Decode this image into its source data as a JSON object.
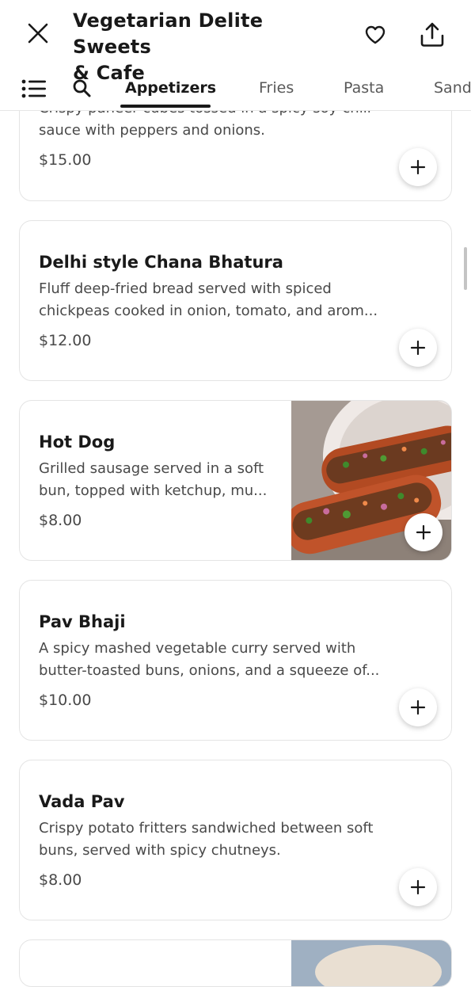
{
  "header": {
    "title_line1": "Vegetarian Delite Sweets",
    "title_line2": "& Cafe",
    "close_icon": "close-icon",
    "favorite_icon": "heart-icon",
    "share_icon": "share-icon"
  },
  "nav": {
    "list_icon": "list-icon",
    "search_icon": "search-icon",
    "tabs": [
      {
        "label": "Appetizers",
        "active": true
      },
      {
        "label": "Fries",
        "active": false
      },
      {
        "label": "Pasta",
        "active": false
      },
      {
        "label": "Sand",
        "active": false
      }
    ]
  },
  "items": [
    {
      "name": "",
      "desc_line1": "Crispy paneer cubes tossed in a spicy soy-chili",
      "desc_line2": "sauce with peppers and onions.",
      "price": "$15.00"
    },
    {
      "name": "Delhi style Chana Bhatura",
      "desc_line1": "Fluff deep-fried bread served with spiced",
      "desc_line2": "chickpeas cooked in onion, tomato, and arom...",
      "price": "$12.00"
    },
    {
      "name": "Hot Dog",
      "desc_line1": "Grilled sausage served in a soft",
      "desc_line2": "bun, topped with ketchup, mu...",
      "price": "$8.00",
      "image": "hot-dog-photo"
    },
    {
      "name": "Pav Bhaji",
      "desc_line1": "A spicy mashed vegetable curry served with",
      "desc_line2": "butter-toasted buns, onions, and a squeeze of...",
      "price": "$10.00"
    },
    {
      "name": "Vada Pav",
      "desc_line1": "Crispy potato fritters sandwiched between soft",
      "desc_line2": "buns, served with spicy chutneys.",
      "price": "$8.00"
    }
  ],
  "add_icon": "plus-icon",
  "colors": {
    "text": "#191919",
    "secondary_text": "#494949",
    "card_border": "#e4e4e4",
    "bun": "#c0532a"
  }
}
